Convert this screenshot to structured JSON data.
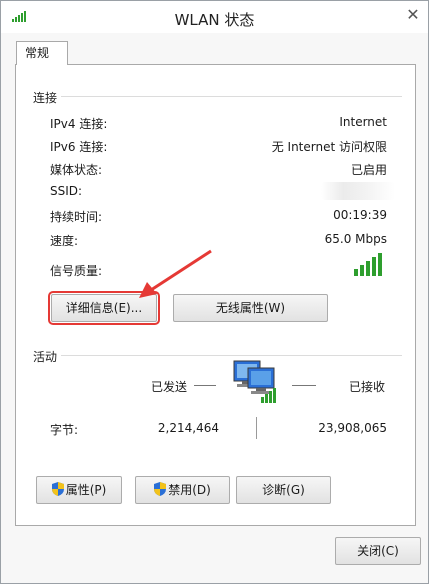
{
  "window": {
    "title": "WLAN 状态",
    "close_glyph": "✕"
  },
  "tabs": [
    {
      "label": "常规"
    }
  ],
  "connection": {
    "section_label": "连接",
    "rows": [
      {
        "label": "IPv4 连接:",
        "value": "Internet"
      },
      {
        "label": "IPv6 连接:",
        "value": "无 Internet 访问权限"
      },
      {
        "label": "媒体状态:",
        "value": "已启用"
      },
      {
        "label": "SSID:",
        "value": ""
      },
      {
        "label": "持续时间:",
        "value": "00:19:39"
      },
      {
        "label": "速度:",
        "value": "65.0 Mbps"
      }
    ],
    "signal_label": "信号质量:",
    "signal_bars_total": 5,
    "signal_bars_filled": 5,
    "details_button": "详细信息(E)...",
    "wireless_props_button": "无线属性(W)"
  },
  "activity": {
    "section_label": "活动",
    "sent_label": "已发送",
    "received_label": "已接收",
    "bytes_label": "字节:",
    "bytes_sent": "2,214,464",
    "bytes_received": "23,908,065",
    "properties_button": "属性(P)",
    "disable_button": "禁用(D)",
    "diagnose_button": "诊断(G)"
  },
  "footer": {
    "close_button": "关闭(C)"
  },
  "colors": {
    "signal_green": "#2e9e2e",
    "highlight_red": "#e53935",
    "shield_blue": "#2a6fd6",
    "shield_yellow": "#f2c21b"
  }
}
